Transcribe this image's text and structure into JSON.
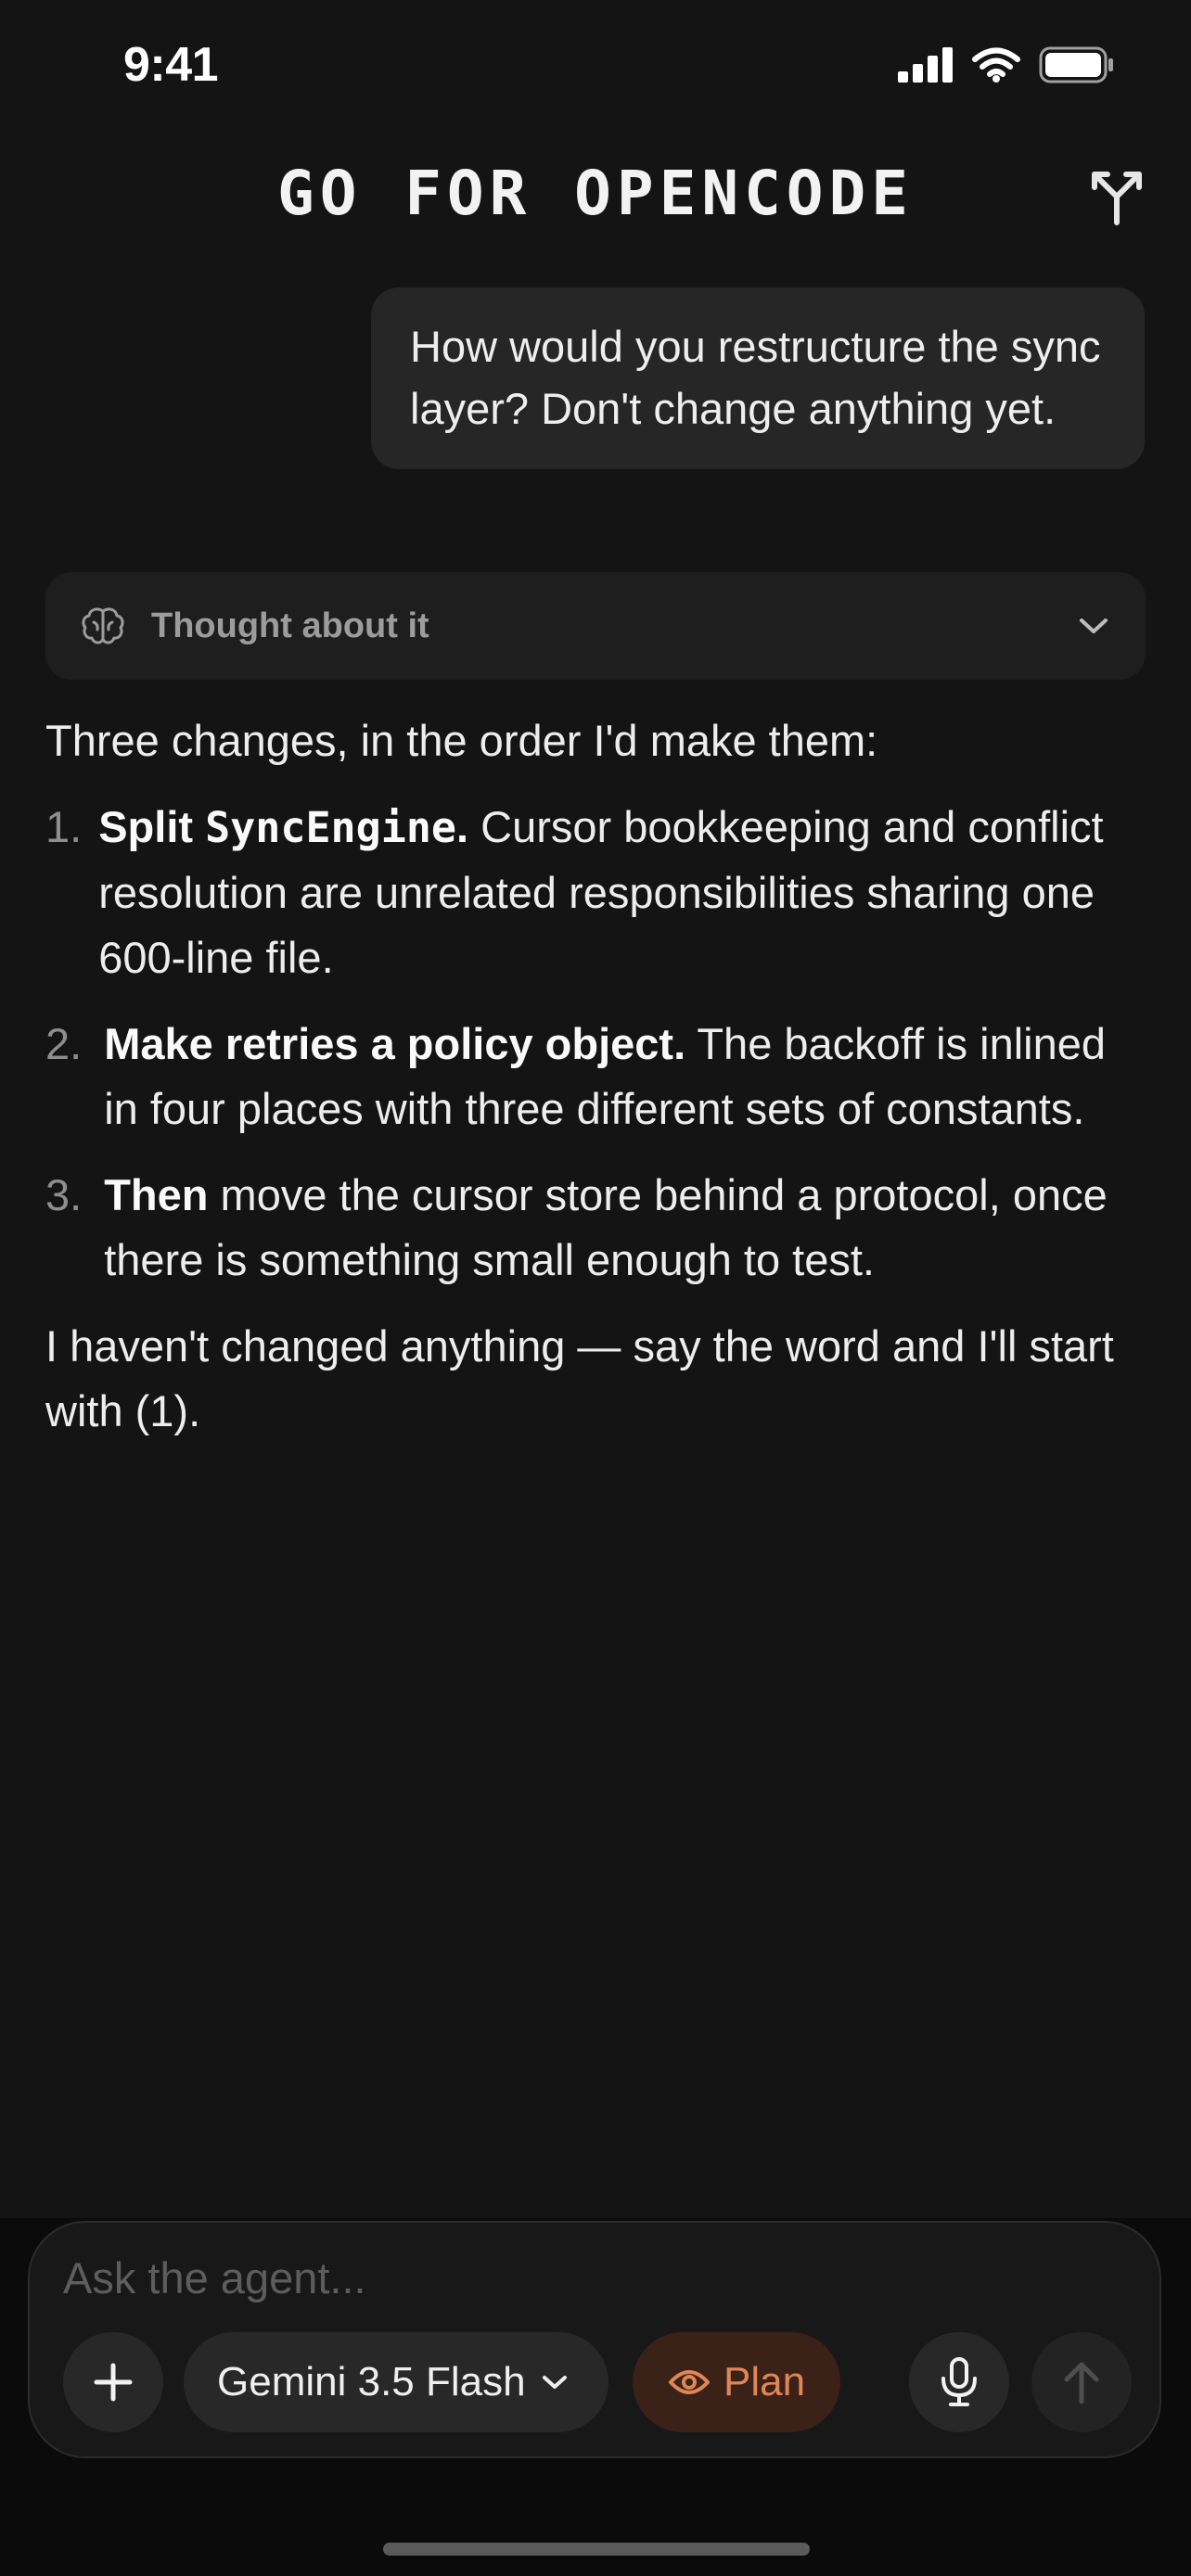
{
  "status_bar": {
    "time": "9:41"
  },
  "header": {
    "title": "GO FOR OPENCODE"
  },
  "conversation": {
    "user_message": "How would you restructure the sync layer? Don't change anything yet.",
    "thought": {
      "label": "Thought about it"
    },
    "answer": {
      "intro": "Three changes, in the order I'd make them:",
      "items": [
        {
          "number": "1.",
          "bold": "Split ",
          "code": "SyncEngine",
          "bold_after": ".",
          "rest": " Cursor bookkeeping and conflict resolution are unrelated responsibilities sharing one 600-line file."
        },
        {
          "number": "2.",
          "bold": "Make retries a policy object.",
          "rest": " The backoff is inlined in four places with three different sets of constants."
        },
        {
          "number": "3.",
          "bold": "Then",
          "rest": " move the cursor store behind a protocol, once there is something small enough to test."
        }
      ],
      "outro": "I haven't changed anything — say the word and I'll start with (1)."
    }
  },
  "composer": {
    "placeholder": "Ask the agent...",
    "model": "Gemini 3.5 Flash",
    "mode": "Plan"
  },
  "colors": {
    "background": "#141414",
    "plan_accent": "#e08656",
    "bubble": "#262626"
  }
}
